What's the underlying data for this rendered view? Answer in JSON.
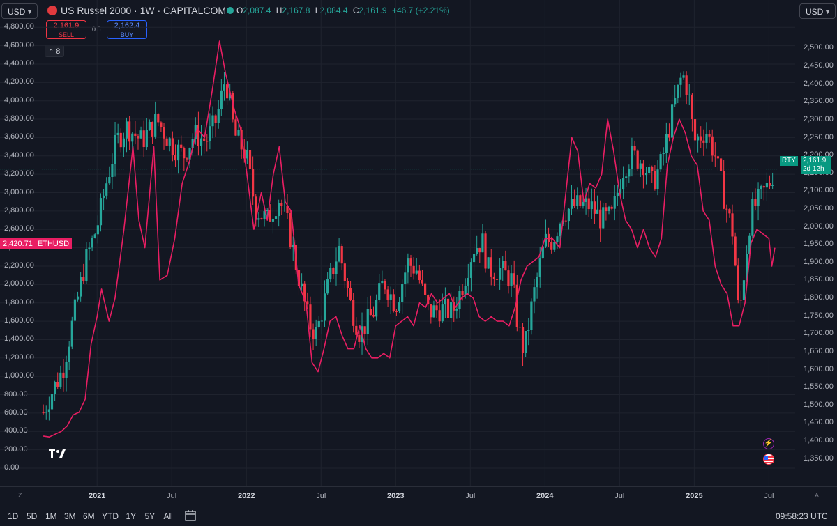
{
  "header": {
    "currency_left": "USD",
    "currency_right": "USD",
    "title": "US Russel 2000 · 1W · CAPITALCOM",
    "ohlc": {
      "o_label": "O",
      "o": "2,087.4",
      "h_label": "H",
      "h": "2,167.8",
      "l_label": "L",
      "l": "2,084.4",
      "c_label": "C",
      "c": "2,161.9",
      "change": "+46.7 (+2.21%)"
    },
    "sell": {
      "price": "2,161.9",
      "label": "SELL"
    },
    "buy": {
      "price": "2,162.4",
      "label": "BUY"
    },
    "spread": "0.5",
    "indicators_count": "8"
  },
  "colors": {
    "bg": "#131722",
    "up": "#26a69a",
    "down": "#f23645",
    "eth": "#e91e63",
    "grid": "#1f232e"
  },
  "icons": {
    "tv_logo": "tradingview-logo-icon",
    "currency_chevron": "chevron-down-icon",
    "lightning": "lightning-icon",
    "flag": "us-flag-icon"
  },
  "tv_logo_text": "TV",
  "tv_logo_text_note": "",
  "chart_data": {
    "type": "candlestick-overlay",
    "x_ticks": [
      {
        "label": "2021",
        "bold": true
      },
      {
        "label": "Jul",
        "bold": false
      },
      {
        "label": "2022",
        "bold": true
      },
      {
        "label": "Jul",
        "bold": false
      },
      {
        "label": "2023",
        "bold": true
      },
      {
        "label": "Jul",
        "bold": false
      },
      {
        "label": "2024",
        "bold": true
      },
      {
        "label": "Jul",
        "bold": false
      },
      {
        "label": "2025",
        "bold": true
      },
      {
        "label": "Jul",
        "bold": false
      }
    ],
    "x_tick_dates": [
      2021.0,
      2021.5,
      2022.0,
      2022.5,
      2023.0,
      2023.5,
      2024.0,
      2024.5,
      2025.0,
      2025.5
    ],
    "x_range": [
      2020.63,
      2025.545
    ],
    "left_axis": {
      "name": "ETHUSD",
      "range": [
        0,
        4870
      ],
      "ticks": [
        "4,800.00",
        "4,600.00",
        "4,400.00",
        "4,200.00",
        "4,000.00",
        "3,800.00",
        "3,600.00",
        "3,400.00",
        "3,200.00",
        "3,000.00",
        "2,800.00",
        "2,600.00",
        "2,400.00",
        "2,200.00",
        "2,000.00",
        "1,800.00",
        "1,600.00",
        "1,400.00",
        "1,200.00",
        "1,000.00",
        "800.00",
        "600.00",
        "400.00",
        "200.00",
        "0.00"
      ],
      "tick_values": [
        4800,
        4600,
        4400,
        4200,
        4000,
        3800,
        3600,
        3400,
        3200,
        3000,
        2800,
        2600,
        2400,
        2200,
        2000,
        1800,
        1600,
        1400,
        1200,
        1000,
        800,
        600,
        400,
        200,
        0
      ]
    },
    "right_axis": {
      "name": "RTY",
      "range": [
        1324,
        2577
      ],
      "ticks": [
        "2,500.00",
        "2,450.00",
        "2,400.00",
        "2,350.00",
        "2,300.00",
        "2,250.00",
        "2,200.00",
        "2,150.00",
        "2,100.00",
        "2,050.00",
        "2,000.00",
        "1,950.00",
        "1,900.00",
        "1,850.00",
        "1,800.00",
        "1,750.00",
        "1,700.00",
        "1,650.00",
        "1,600.00",
        "1,550.00",
        "1,500.00",
        "1,450.00",
        "1,400.00",
        "1,350.00"
      ],
      "tick_values": [
        2500,
        2450,
        2400,
        2350,
        2300,
        2250,
        2200,
        2150,
        2100,
        2050,
        2000,
        1950,
        1900,
        1850,
        1800,
        1750,
        1700,
        1650,
        1600,
        1550,
        1500,
        1450,
        1400,
        1350
      ]
    },
    "eth_last": {
      "label": "ETHUSD",
      "value": "2,420.71"
    },
    "rty_last": {
      "label": "RTY",
      "value": "2,161.9",
      "countdown": "2d 12h"
    },
    "rty_last_value": 2161.9,
    "rty_anchors": [
      [
        2020.64,
        1480
      ],
      [
        2020.7,
        1540
      ],
      [
        2020.77,
        1600
      ],
      [
        2020.85,
        1760
      ],
      [
        2020.92,
        1900
      ],
      [
        2021.0,
        2000
      ],
      [
        2021.06,
        2120
      ],
      [
        2021.13,
        2240
      ],
      [
        2021.2,
        2280
      ],
      [
        2021.3,
        2240
      ],
      [
        2021.4,
        2300
      ],
      [
        2021.5,
        2230
      ],
      [
        2021.58,
        2200
      ],
      [
        2021.65,
        2260
      ],
      [
        2021.73,
        2240
      ],
      [
        2021.8,
        2300
      ],
      [
        2021.86,
        2420
      ],
      [
        2021.92,
        2260
      ],
      [
        2022.0,
        2200
      ],
      [
        2022.06,
        2050
      ],
      [
        2022.14,
        2020
      ],
      [
        2022.22,
        2080
      ],
      [
        2022.28,
        2000
      ],
      [
        2022.35,
        1860
      ],
      [
        2022.42,
        1730
      ],
      [
        2022.47,
        1700
      ],
      [
        2022.55,
        1840
      ],
      [
        2022.62,
        1940
      ],
      [
        2022.7,
        1780
      ],
      [
        2022.76,
        1700
      ],
      [
        2022.85,
        1760
      ],
      [
        2022.92,
        1850
      ],
      [
        2023.0,
        1780
      ],
      [
        2023.08,
        1900
      ],
      [
        2023.14,
        1880
      ],
      [
        2023.22,
        1760
      ],
      [
        2023.3,
        1770
      ],
      [
        2023.38,
        1760
      ],
      [
        2023.45,
        1840
      ],
      [
        2023.52,
        1940
      ],
      [
        2023.58,
        1960
      ],
      [
        2023.62,
        1880
      ],
      [
        2023.7,
        1880
      ],
      [
        2023.78,
        1850
      ],
      [
        2023.82,
        1720
      ],
      [
        2023.86,
        1650
      ],
      [
        2023.92,
        1800
      ],
      [
        2024.0,
        1960
      ],
      [
        2024.05,
        1960
      ],
      [
        2024.12,
        2040
      ],
      [
        2024.2,
        2060
      ],
      [
        2024.3,
        2060
      ],
      [
        2024.38,
        2020
      ],
      [
        2024.45,
        2030
      ],
      [
        2024.52,
        2160
      ],
      [
        2024.58,
        2200
      ],
      [
        2024.66,
        2180
      ],
      [
        2024.72,
        2120
      ],
      [
        2024.78,
        2180
      ],
      [
        2024.86,
        2330
      ],
      [
        2024.92,
        2430
      ],
      [
        2024.96,
        2380
      ],
      [
        2025.0,
        2240
      ],
      [
        2025.08,
        2270
      ],
      [
        2025.14,
        2200
      ],
      [
        2025.2,
        2080
      ],
      [
        2025.26,
        1980
      ],
      [
        2025.3,
        1740
      ],
      [
        2025.34,
        1900
      ],
      [
        2025.38,
        2040
      ],
      [
        2025.44,
        2080
      ],
      [
        2025.5,
        2120
      ],
      [
        2025.54,
        2160
      ]
    ],
    "eth_points": [
      [
        2020.64,
        350
      ],
      [
        2020.68,
        340
      ],
      [
        2020.72,
        370
      ],
      [
        2020.76,
        400
      ],
      [
        2020.8,
        460
      ],
      [
        2020.84,
        580
      ],
      [
        2020.88,
        610
      ],
      [
        2020.92,
        750
      ],
      [
        2020.96,
        1350
      ],
      [
        2021.0,
        1650
      ],
      [
        2021.03,
        1950
      ],
      [
        2021.08,
        1600
      ],
      [
        2021.12,
        1850
      ],
      [
        2021.18,
        2600
      ],
      [
        2021.24,
        3500
      ],
      [
        2021.28,
        2700
      ],
      [
        2021.32,
        2400
      ],
      [
        2021.38,
        3500
      ],
      [
        2021.42,
        2050
      ],
      [
        2021.47,
        2100
      ],
      [
        2021.52,
        2500
      ],
      [
        2021.57,
        3100
      ],
      [
        2021.62,
        3350
      ],
      [
        2021.67,
        3700
      ],
      [
        2021.72,
        3600
      ],
      [
        2021.77,
        4100
      ],
      [
        2021.82,
        4650
      ],
      [
        2021.86,
        4300
      ],
      [
        2021.92,
        3900
      ],
      [
        2021.96,
        3700
      ],
      [
        2022.0,
        3250
      ],
      [
        2022.05,
        2600
      ],
      [
        2022.1,
        3000
      ],
      [
        2022.14,
        2700
      ],
      [
        2022.18,
        3200
      ],
      [
        2022.22,
        3500
      ],
      [
        2022.26,
        2900
      ],
      [
        2022.3,
        2800
      ],
      [
        2022.35,
        2000
      ],
      [
        2022.4,
        1800
      ],
      [
        2022.44,
        1150
      ],
      [
        2022.48,
        1050
      ],
      [
        2022.52,
        1300
      ],
      [
        2022.56,
        1600
      ],
      [
        2022.6,
        1650
      ],
      [
        2022.64,
        1450
      ],
      [
        2022.68,
        1300
      ],
      [
        2022.72,
        1300
      ],
      [
        2022.76,
        1550
      ],
      [
        2022.8,
        1300
      ],
      [
        2022.84,
        1200
      ],
      [
        2022.88,
        1200
      ],
      [
        2022.92,
        1250
      ],
      [
        2022.96,
        1200
      ],
      [
        2023.0,
        1550
      ],
      [
        2023.04,
        1600
      ],
      [
        2023.08,
        1650
      ],
      [
        2023.12,
        1550
      ],
      [
        2023.16,
        1800
      ],
      [
        2023.2,
        1750
      ],
      [
        2023.24,
        1900
      ],
      [
        2023.28,
        1800
      ],
      [
        2023.32,
        1850
      ],
      [
        2023.36,
        1900
      ],
      [
        2023.4,
        1750
      ],
      [
        2023.44,
        1850
      ],
      [
        2023.48,
        1900
      ],
      [
        2023.52,
        1850
      ],
      [
        2023.56,
        1650
      ],
      [
        2023.6,
        1600
      ],
      [
        2023.64,
        1650
      ],
      [
        2023.68,
        1600
      ],
      [
        2023.72,
        1600
      ],
      [
        2023.76,
        1550
      ],
      [
        2023.8,
        1750
      ],
      [
        2023.84,
        2050
      ],
      [
        2023.88,
        2200
      ],
      [
        2023.92,
        2250
      ],
      [
        2023.96,
        2300
      ],
      [
        2024.0,
        2500
      ],
      [
        2024.05,
        2500
      ],
      [
        2024.1,
        2400
      ],
      [
        2024.14,
        3000
      ],
      [
        2024.18,
        3600
      ],
      [
        2024.22,
        3450
      ],
      [
        2024.26,
        2900
      ],
      [
        2024.3,
        3100
      ],
      [
        2024.34,
        3050
      ],
      [
        2024.38,
        3200
      ],
      [
        2024.42,
        3800
      ],
      [
        2024.46,
        3450
      ],
      [
        2024.5,
        3000
      ],
      [
        2024.54,
        2700
      ],
      [
        2024.58,
        2600
      ],
      [
        2024.62,
        2400
      ],
      [
        2024.66,
        2600
      ],
      [
        2024.7,
        2400
      ],
      [
        2024.74,
        2300
      ],
      [
        2024.78,
        2500
      ],
      [
        2024.82,
        3300
      ],
      [
        2024.86,
        3600
      ],
      [
        2024.9,
        3800
      ],
      [
        2024.94,
        3650
      ],
      [
        2024.98,
        3400
      ],
      [
        2025.02,
        3300
      ],
      [
        2025.06,
        2800
      ],
      [
        2025.1,
        2700
      ],
      [
        2025.14,
        2200
      ],
      [
        2025.18,
        2000
      ],
      [
        2025.22,
        1900
      ],
      [
        2025.26,
        1550
      ],
      [
        2025.3,
        1550
      ],
      [
        2025.34,
        1800
      ],
      [
        2025.38,
        2450
      ],
      [
        2025.42,
        2600
      ],
      [
        2025.46,
        2550
      ],
      [
        2025.5,
        2500
      ],
      [
        2025.52,
        2200
      ],
      [
        2025.54,
        2400
      ]
    ]
  },
  "bottom": {
    "ranges": [
      "1D",
      "5D",
      "1M",
      "3M",
      "6M",
      "YTD",
      "1Y",
      "5Y",
      "All"
    ],
    "clock": "09:58:23 UTC",
    "corner_left": "Z",
    "corner_right": "A"
  }
}
